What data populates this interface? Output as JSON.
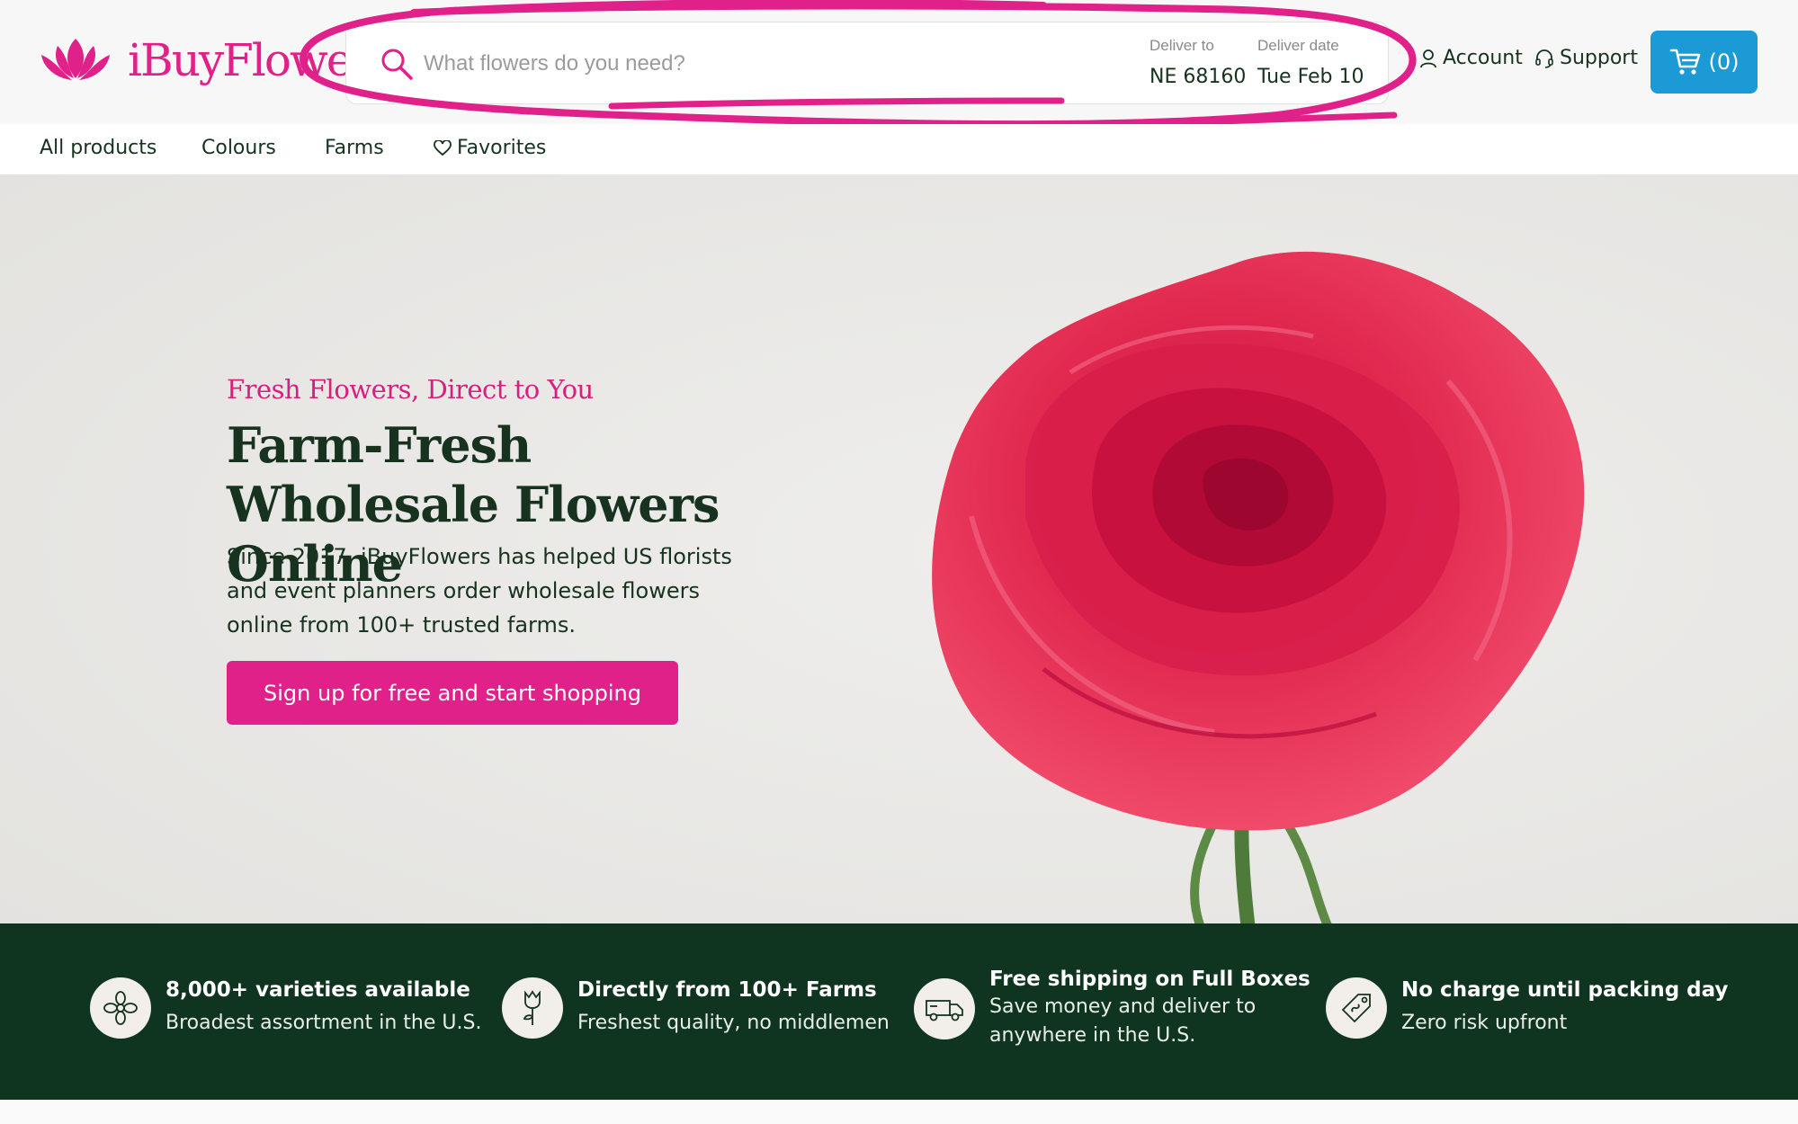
{
  "brand": {
    "name": "iBuyFlowers",
    "primary_color": "#e0218a",
    "accent_color": "#1c9ad6",
    "dark_green": "#0f3520",
    "logo_icon": "lotus-icon"
  },
  "search": {
    "placeholder": "What flowers do you need?",
    "value": "",
    "icon": "search-icon"
  },
  "delivery": {
    "to_label": "Deliver to",
    "to_value": "NE 68160",
    "date_label": "Deliver date",
    "date_value": "Tue Feb 10"
  },
  "header": {
    "account_label": "Account",
    "account_icon": "user-icon",
    "support_label": "Support",
    "support_icon": "headset-icon",
    "cart_label": "(0)",
    "cart_icon": "cart-icon"
  },
  "nav": {
    "items": [
      {
        "label": "All products"
      },
      {
        "label": "Colours"
      },
      {
        "label": "Farms"
      },
      {
        "label": "Favorites",
        "icon": "heart-icon"
      }
    ]
  },
  "hero": {
    "eyebrow": "Fresh Flowers, Direct to You",
    "title": "Farm-Fresh Wholesale Flowers Online",
    "body": "Since 2017, iBuyFlowers has helped US florists and event planners order wholesale flowers online from 100+ trusted farms.",
    "cta_label": "Sign up for free and start shopping",
    "image": "red-rose-image"
  },
  "features": [
    {
      "icon": "flower-icon",
      "title": "8,000+ varieties available",
      "subtitle": "Broadest assortment in the U.S."
    },
    {
      "icon": "rose-stem-icon",
      "title": "Directly from 100+ Farms",
      "subtitle": "Freshest quality, no middlemen"
    },
    {
      "icon": "truck-icon",
      "title": "Free shipping on Full Boxes",
      "subtitle": "Save money and deliver to anywhere in the U.S."
    },
    {
      "icon": "price-tag-icon",
      "title": "No charge until packing day",
      "subtitle": "Zero risk upfront"
    }
  ],
  "annotation": {
    "color": "#e0218a",
    "type": "hand-drawn-circle"
  }
}
